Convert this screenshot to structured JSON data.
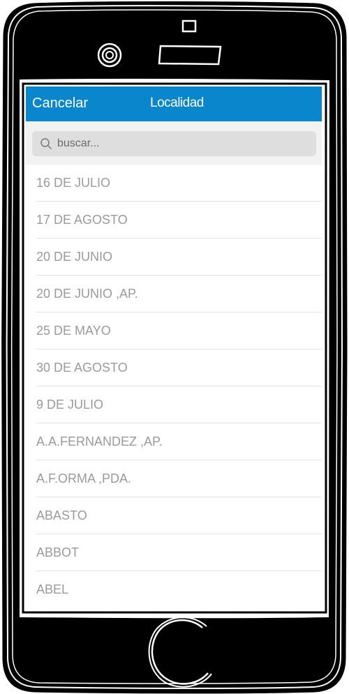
{
  "navbar": {
    "cancel_label": "Cancelar",
    "title": "Localidad",
    "background_color": "#0a86cc"
  },
  "search": {
    "placeholder": "buscar...",
    "value": "",
    "icon": "search-icon"
  },
  "list": {
    "items": [
      {
        "label": "16 DE JULIO"
      },
      {
        "label": "17 DE AGOSTO"
      },
      {
        "label": "20 DE JUNIO"
      },
      {
        "label": "20 DE JUNIO ,AP."
      },
      {
        "label": "25 DE MAYO"
      },
      {
        "label": "30 DE AGOSTO"
      },
      {
        "label": "9 DE JULIO"
      },
      {
        "label": "A.A.FERNANDEZ ,AP."
      },
      {
        "label": "A.F.ORMA ,PDA."
      },
      {
        "label": "ABASTO"
      },
      {
        "label": "ABBOT"
      },
      {
        "label": "ABEL"
      }
    ]
  },
  "device": {
    "frame_color": "#000000",
    "camera_icon": "camera-icon",
    "speaker_icon": "speaker-icon",
    "home_button_icon": "home-button-icon"
  }
}
